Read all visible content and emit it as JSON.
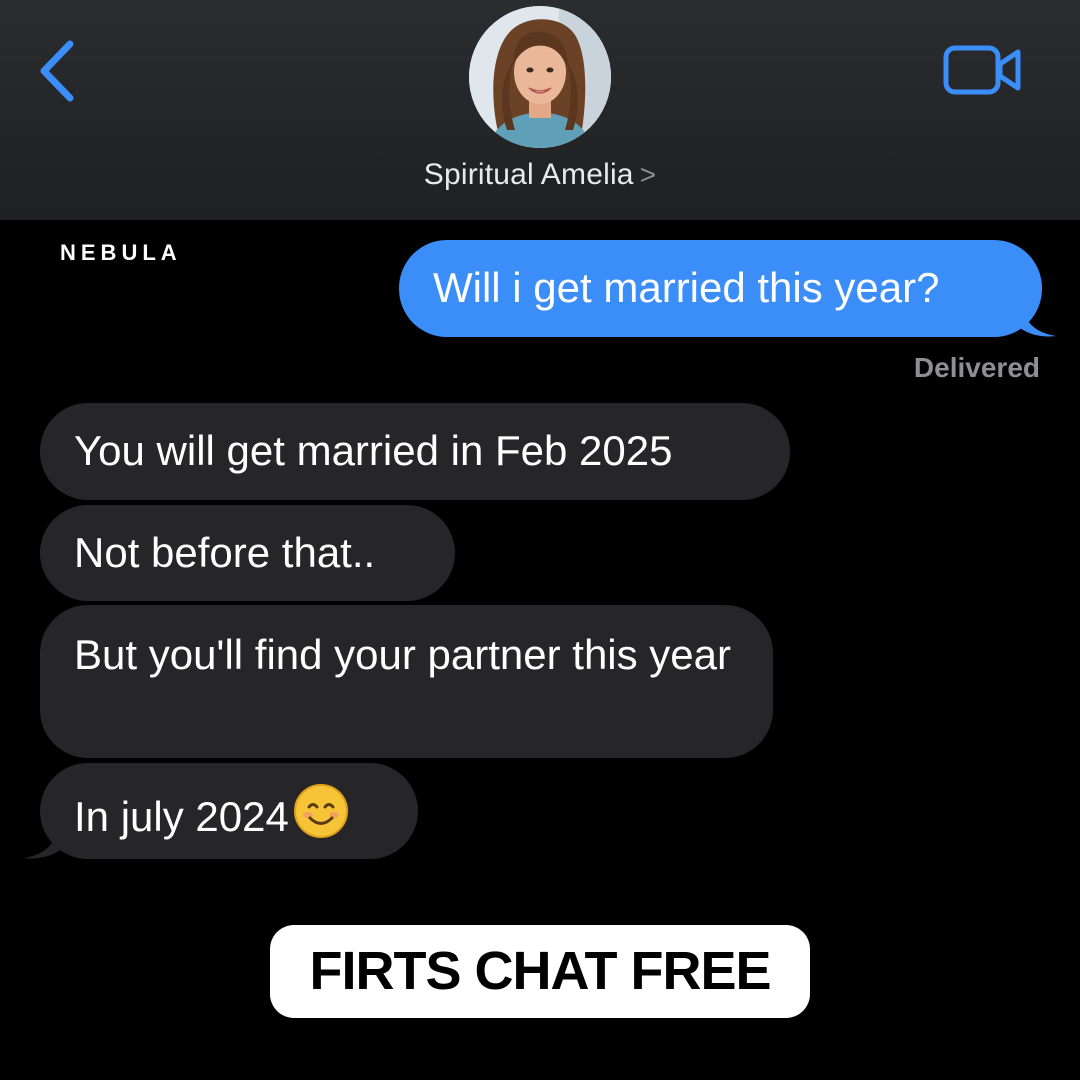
{
  "header": {
    "contact_name": "Spiritual Amelia",
    "chevron": ">",
    "back_icon": "chevron-left-icon",
    "video_icon": "video-camera-icon",
    "accent_color": "#3b8df8"
  },
  "brand": {
    "logo_text": "NEBULA"
  },
  "messages": {
    "outgoing": [
      {
        "text": "Will i get married this year?"
      }
    ],
    "delivered_label": "Delivered",
    "incoming": [
      {
        "text": "You will get married in Feb 2025"
      },
      {
        "text": "Not before that.."
      },
      {
        "text": "But you'll find your partner this year"
      },
      {
        "text": "In july 2024",
        "emoji": "smiling-face-icon"
      }
    ]
  },
  "cta": {
    "label": "FIRTS CHAT FREE"
  },
  "colors": {
    "outgoing_bubble": "#3b8df8",
    "incoming_bubble": "#262628",
    "background": "#000000",
    "header_bg": "#232427"
  }
}
